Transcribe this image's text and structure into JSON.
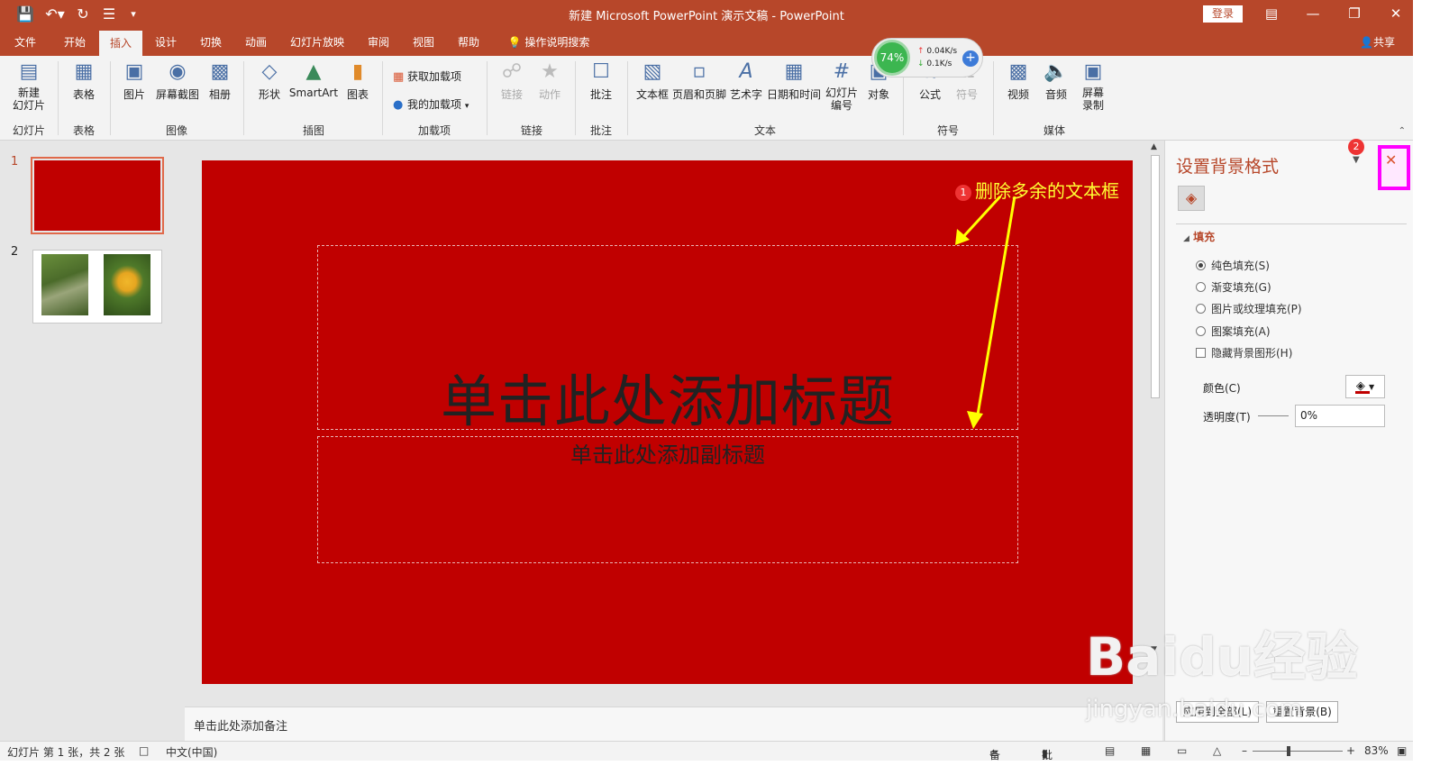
{
  "titlebar": {
    "title": "新建 Microsoft PowerPoint 演示文稿 - PowerPoint",
    "login_label": "登录",
    "bg_color": "#b7472a"
  },
  "tabs": [
    "文件",
    "开始",
    "插入",
    "设计",
    "切换",
    "动画",
    "幻灯片放映",
    "审阅",
    "视图",
    "帮助",
    "操作说明搜索"
  ],
  "active_tab": "插入",
  "share_label": "共享",
  "net_widget": {
    "percent": "74%",
    "up": "0.04K/s",
    "down": "0.1K/s"
  },
  "ribbon": {
    "new_slide": "新建\n幻灯片",
    "table": "表格",
    "picture": "图片",
    "screenshot": "屏幕截图",
    "album": "相册",
    "shapes": "形状",
    "smartart": "SmartArt",
    "chart": "图表",
    "get_addins": "获取加载项",
    "my_addins": "我的加载项",
    "link": "链接",
    "action": "动作",
    "comment": "批注",
    "textbox": "文本框",
    "header_footer": "页眉和页脚",
    "wordart": "艺术字",
    "datetime": "日期和时间",
    "slide_number": "幻灯片\n编号",
    "object": "对象",
    "equation": "公式",
    "symbol": "符号",
    "video": "视频",
    "audio": "音频",
    "screen_record": "屏幕\n录制",
    "groups": {
      "slides": "幻灯片",
      "tables": "表格",
      "images": "图像",
      "illustrations": "插图",
      "addins": "加载项",
      "links": "链接",
      "comments": "批注",
      "text": "文本",
      "symbols": "符号",
      "media": "媒体"
    }
  },
  "thumbnails": [
    {
      "number": "1"
    },
    {
      "number": "2"
    }
  ],
  "slide": {
    "title_placeholder": "单击此处添加标题",
    "subtitle_placeholder": "单击此处添加副标题",
    "background": "#c00000"
  },
  "annotations": {
    "step1_num": "1",
    "step1_text": "删除多余的文本框",
    "step2_num": "2"
  },
  "notes_placeholder": "单击此处添加备注",
  "format_pane": {
    "title": "设置背景格式",
    "section": "填充",
    "options": [
      "纯色填充(S)",
      "渐变填充(G)",
      "图片或纹理填充(P)",
      "图案填充(A)"
    ],
    "selected_option": "纯色填充(S)",
    "hide_bg_graphics": "隐藏背景图形(H)",
    "color_label": "颜色(C)",
    "transparency_label": "透明度(T)",
    "transparency_value": "0%",
    "apply_all": "应用到全部(L)",
    "reset": "重置背景(B)"
  },
  "statusbar": {
    "slide_info": "幻灯片 第 1 张，共 2 张",
    "language": "中文(中国)",
    "notes": "备注",
    "comments": "批注",
    "zoom": "83%"
  },
  "watermark": {
    "brand": "Baidu经验",
    "url": "jingyan.baidu.com"
  }
}
